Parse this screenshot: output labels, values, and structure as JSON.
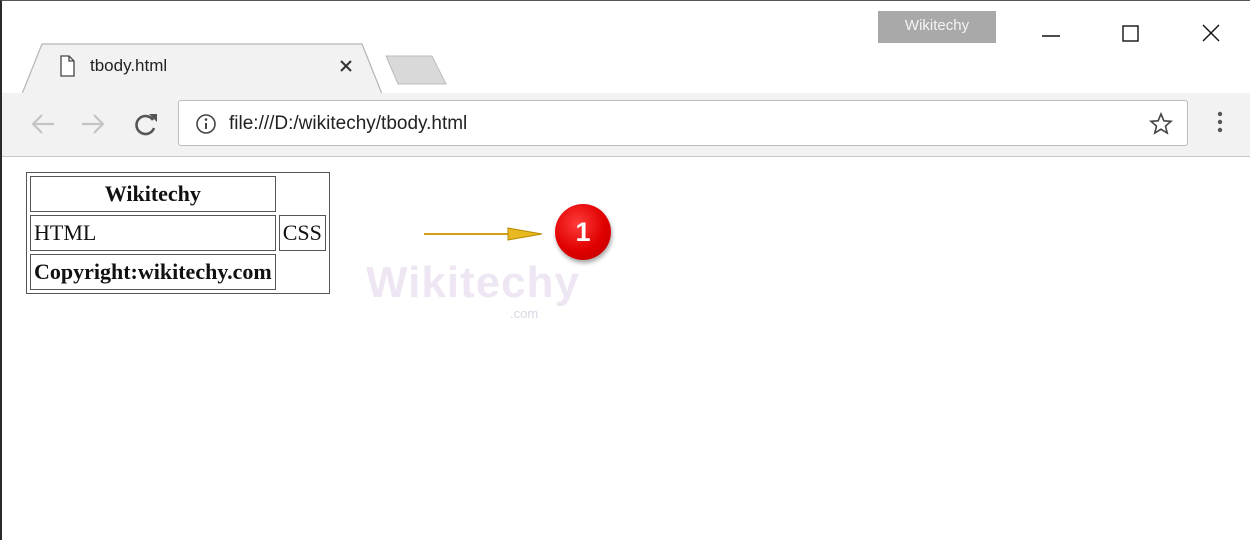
{
  "window": {
    "profile_name": "Wikitechy"
  },
  "tab": {
    "title": "tbody.html"
  },
  "toolbar": {
    "url": "file:///D:/wikitechy/tbody.html"
  },
  "page": {
    "table": {
      "header": "Wikitechy",
      "body": [
        "HTML",
        "CSS"
      ],
      "footer": "Copyright:wikitechy.com"
    },
    "watermark": "Wikitechy",
    "watermark_sub": ".com",
    "callout_number": "1"
  },
  "colors": {
    "callout_red": "#e00000",
    "arrow_gold": "#d4a017",
    "profile_badge": "#a9a9a9",
    "toolbar_bg": "#f2f2f2"
  }
}
